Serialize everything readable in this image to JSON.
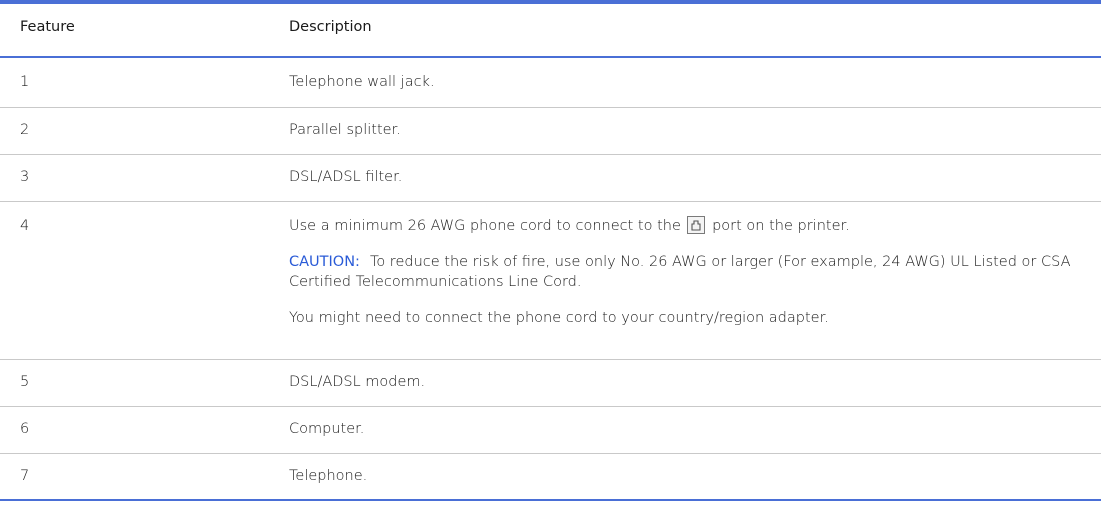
{
  "table": {
    "headers": {
      "feature": "Feature",
      "description": "Description"
    },
    "rows": [
      {
        "feature": "1",
        "description": "Telephone wall jack."
      },
      {
        "feature": "2",
        "description": "Parallel splitter."
      },
      {
        "feature": "3",
        "description": "DSL/ADSL filter."
      },
      {
        "feature": "4",
        "description_pre": "Use a minimum 26 AWG phone cord to connect to the",
        "description_icon": "phone-port-icon",
        "description_post": "port on the printer.",
        "caution_label": "CAUTION:",
        "caution_text": "To reduce the risk of fire, use only No. 26 AWG or larger (For example, 24 AWG) UL Listed or CSA Certified Telecommunications Line Cord.",
        "note": "You might need to connect the phone cord to your country/region adapter."
      },
      {
        "feature": "5",
        "description": "DSL/ADSL modem."
      },
      {
        "feature": "6",
        "description": "Computer."
      },
      {
        "feature": "7",
        "description": "Telephone."
      }
    ]
  },
  "colors": {
    "rule": "#4a6fd6",
    "caution": "#2a5bd7",
    "divider": "#c9c9c9"
  }
}
